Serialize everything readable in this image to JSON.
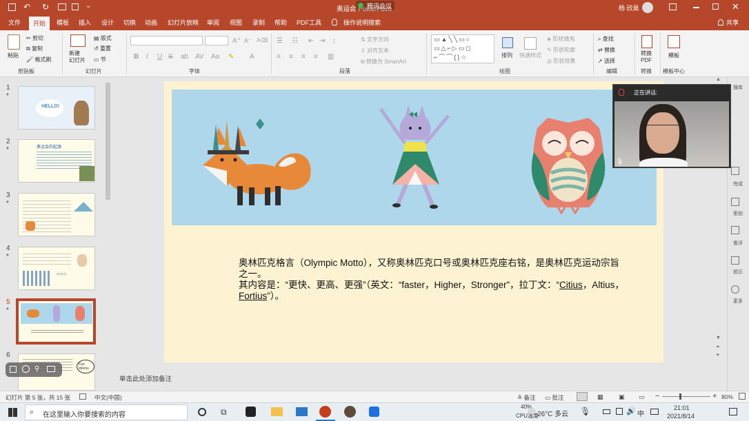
{
  "titlebar": {
    "title": "奥运会 PowerPoint",
    "meeting": "腾讯会议",
    "user": "杨 欣昊"
  },
  "tabs": [
    "文件",
    "开始",
    "模板",
    "插入",
    "设计",
    "切换",
    "动画",
    "幻灯片放映",
    "审阅",
    "视图",
    "录制",
    "帮助",
    "PDF工具",
    "操作说明搜索"
  ],
  "share_label": "共享",
  "ribbon": {
    "paste": "粘贴",
    "cut": "剪切",
    "copy": "复制",
    "format_painter": "格式刷",
    "clipboard": "剪贴板",
    "new_slide": "新建\n幻灯片",
    "layout": "版式",
    "reset": "重置",
    "section": "节",
    "slides": "幻灯片",
    "font": "字体",
    "text_direction": "文字方向",
    "align_text": "对齐文本",
    "smartart": "转换为 SmartArt",
    "paragraph": "段落",
    "arrange": "排列",
    "quick_styles": "快速样式",
    "shape_fill": "形状填充",
    "shape_outline": "形状轮廓",
    "shape_effects": "形状效果",
    "drawing": "绘图",
    "find": "查找",
    "replace": "替换",
    "select": "选择",
    "editing": "编辑",
    "convert_pdf": "转换\nPDF",
    "convert": "转换",
    "template": "模板",
    "template_center": "模板中心"
  },
  "slides": [
    {
      "num": "1",
      "star": "*",
      "thumb_text": "HELLO!"
    },
    {
      "num": "2",
      "star": "*",
      "thumb_text": "奥运会的起源"
    },
    {
      "num": "3",
      "star": "*",
      "thumb_text": ""
    },
    {
      "num": "4",
      "star": "*",
      "thumb_text": ""
    },
    {
      "num": "5",
      "star": "*",
      "thumb_text": ""
    },
    {
      "num": "6",
      "star": "",
      "thumb_text": "Fun Idioms"
    }
  ],
  "slide_body": {
    "line1": "奥林匹克格言（Olympic Motto），又称奥林匹克口号或奥林匹克座右铭，是奥林匹克运动宗旨之一。",
    "line2_a": "其内容是：“更快、更高、更强”（英文：“faster，Higher，Stronger”，拉丁文：“",
    "citius": "Citius",
    "line2_b": "，Altius，",
    "fortius": "Fortius",
    "line2_c": "”）。"
  },
  "notes_placeholder": "单击此处添加备注",
  "video": {
    "speaking_label": "正在讲话:"
  },
  "right_pane": [
    "搜库",
    "完成",
    "索划",
    "看评",
    "预示",
    "更多"
  ],
  "status": {
    "slide_info": "幻灯片 第 5 张，共 15 张",
    "language": "中文(中国)",
    "notes": "备注",
    "comments": "批注",
    "zoom": "80%"
  },
  "taskbar": {
    "search_placeholder": "在这里输入你要搜索的内容",
    "cpu": "40%",
    "cpu_label": "CPU温度",
    "weather": "26°C 多云",
    "ime": "中",
    "time": "21:01",
    "date": "2021/8/14"
  },
  "colors": {
    "accent": "#b7472a",
    "slide_bg": "#fdf3d3",
    "banner": "#aed7ec"
  }
}
